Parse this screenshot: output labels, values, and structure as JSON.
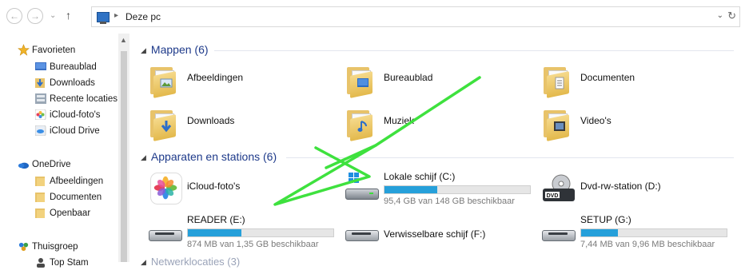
{
  "address_bar": {
    "path": "Deze pc"
  },
  "sidebar": {
    "favorites_header": "Favorieten",
    "favorites": [
      {
        "label": "Bureaublad",
        "icon": "desktop-icon"
      },
      {
        "label": "Downloads",
        "icon": "downloads-icon"
      },
      {
        "label": "Recente locaties",
        "icon": "recent-places-icon"
      },
      {
        "label": "iCloud-foto's",
        "icon": "icloud-photos-icon"
      },
      {
        "label": "iCloud Drive",
        "icon": "icloud-drive-icon"
      }
    ],
    "onedrive_header": "OneDrive",
    "onedrive": [
      {
        "label": "Afbeeldingen",
        "icon": "folder-icon"
      },
      {
        "label": "Documenten",
        "icon": "folder-icon"
      },
      {
        "label": "Openbaar",
        "icon": "folder-icon"
      }
    ],
    "homegroup_header": "Thuisgroep",
    "homegroup_child": "Top Stam"
  },
  "folders_group": {
    "title": "Mappen (6)",
    "items": [
      {
        "label": "Afbeeldingen"
      },
      {
        "label": "Bureaublad"
      },
      {
        "label": "Documenten"
      },
      {
        "label": "Downloads"
      },
      {
        "label": "Muziek"
      },
      {
        "label": "Video's"
      }
    ]
  },
  "devices_group": {
    "title": "Apparaten en stations (6)",
    "items": [
      {
        "label": "iCloud-foto's"
      },
      {
        "label": "Lokale schijf (C:)",
        "detail": "95,4 GB van 148 GB beschikbaar",
        "used_fraction": 0.36
      },
      {
        "label": "Dvd-rw-station (D:)"
      },
      {
        "label": "READER (E:)",
        "detail": "874 MB van 1,35 GB beschikbaar",
        "used_fraction": 0.37
      },
      {
        "label": "Verwisselbare schijf (F:)"
      },
      {
        "label": "SETUP (G:)",
        "detail": "7,44 MB van 9,96 MB beschikbaar",
        "used_fraction": 0.25
      }
    ]
  },
  "next_group_title": "Netwerklocaties (3)",
  "colors": {
    "group_title": "#1e3a8a",
    "drive_bar_fill": "#26a0da",
    "annotation_stroke": "#3ee13e"
  }
}
